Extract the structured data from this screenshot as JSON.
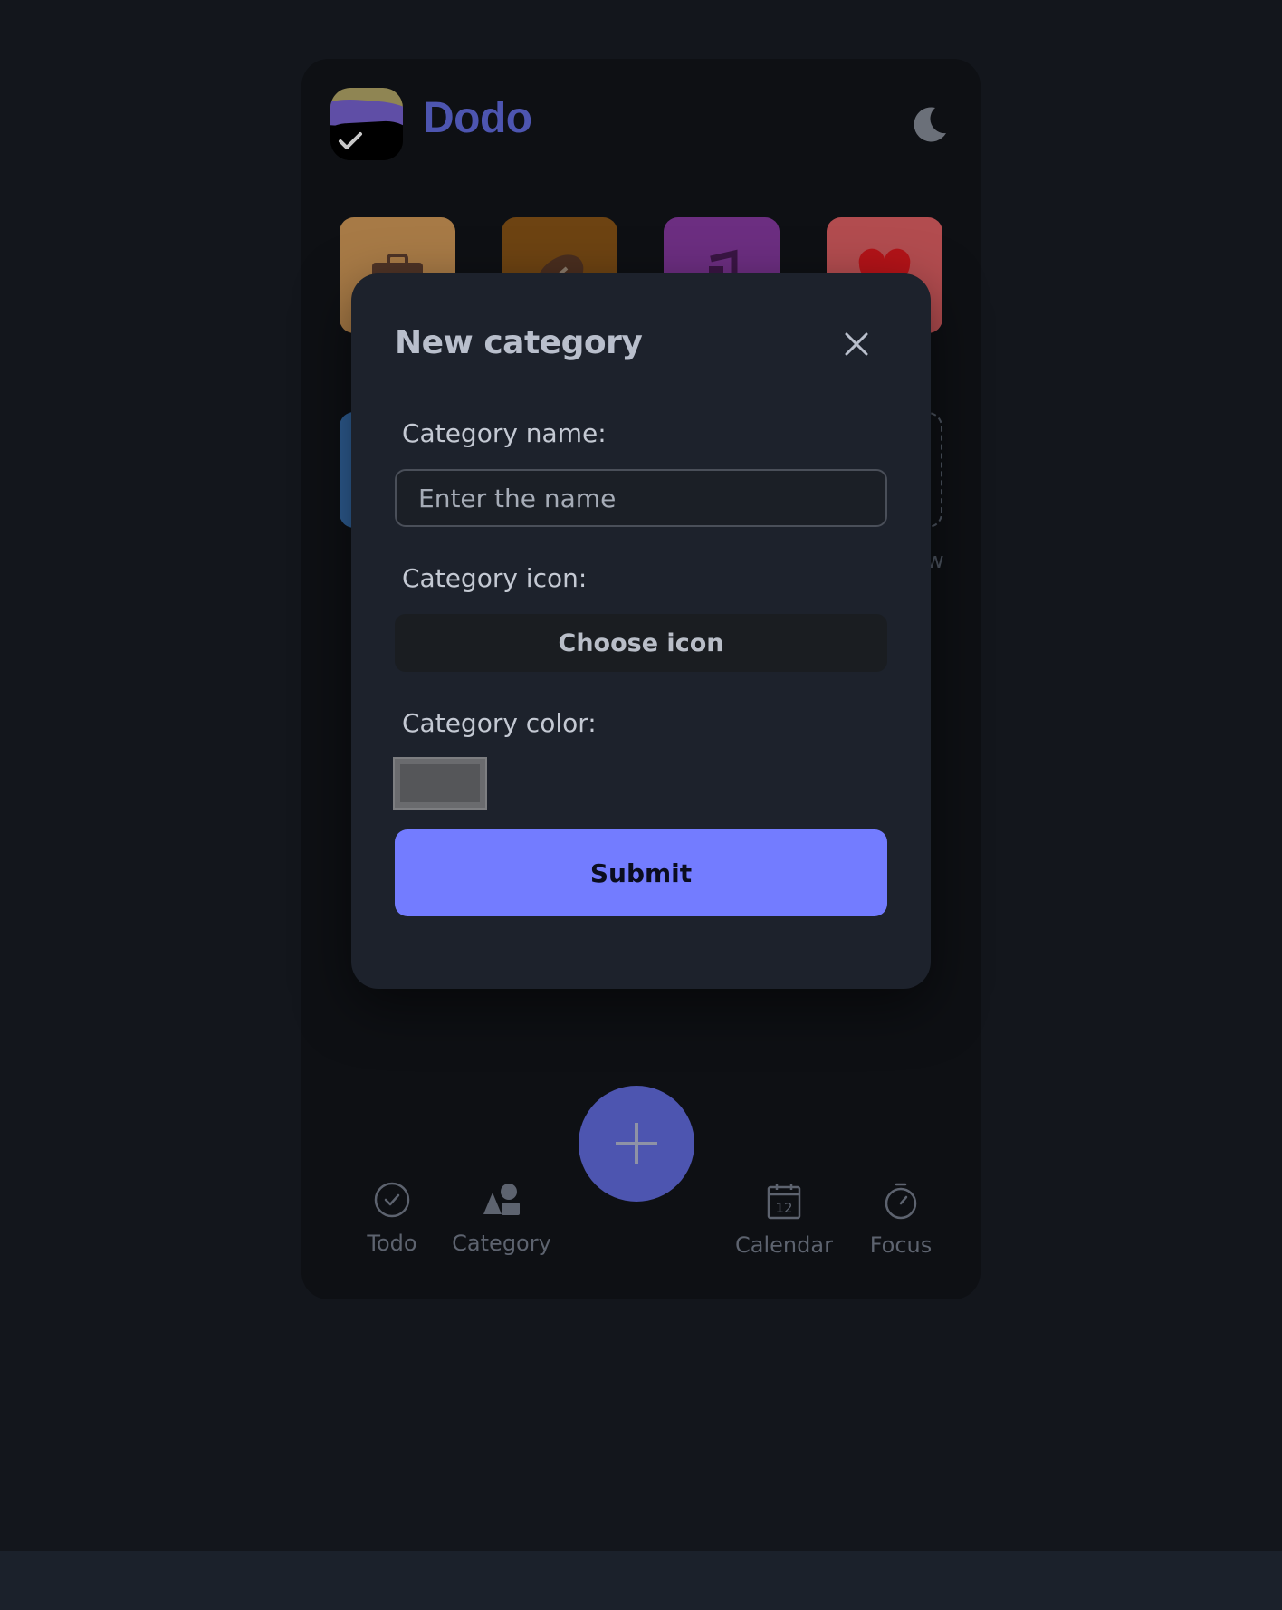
{
  "app": {
    "title": "Dodo",
    "theme_toggle_icon": "moon-icon",
    "logo_icon": "checkmark-icon"
  },
  "categories": [
    {
      "icon": "briefcase-icon",
      "color": "#a77a46"
    },
    {
      "icon": "football-icon",
      "color": "#6d4312"
    },
    {
      "icon": "music-note-icon",
      "color": "#6c2e81"
    },
    {
      "icon": "heart-icon",
      "color": "#b24c4f"
    }
  ],
  "peek": {
    "row2_left_color": "#2e5d93",
    "row2_right_label_fragment": "w"
  },
  "modal": {
    "title": "New category",
    "close_icon": "close-icon",
    "name_label": "Category name:",
    "name_placeholder": "Enter the name",
    "name_value": "",
    "icon_label": "Category icon:",
    "choose_icon_label": "Choose icon",
    "color_label": "Category color:",
    "color_value": "#555659",
    "submit_label": "Submit"
  },
  "nav": {
    "items": [
      {
        "label": "Todo",
        "icon": "check-circle-icon"
      },
      {
        "label": "Category",
        "icon": "shapes-icon"
      },
      {
        "label": "Calendar",
        "icon": "calendar-icon",
        "icon_text": "12"
      },
      {
        "label": "Focus",
        "icon": "stopwatch-icon"
      }
    ],
    "fab_icon": "plus-icon"
  },
  "colors": {
    "accent": "#737cff",
    "brand": "#4d55b0",
    "background": "#13161c",
    "modal": "#1d222c"
  }
}
